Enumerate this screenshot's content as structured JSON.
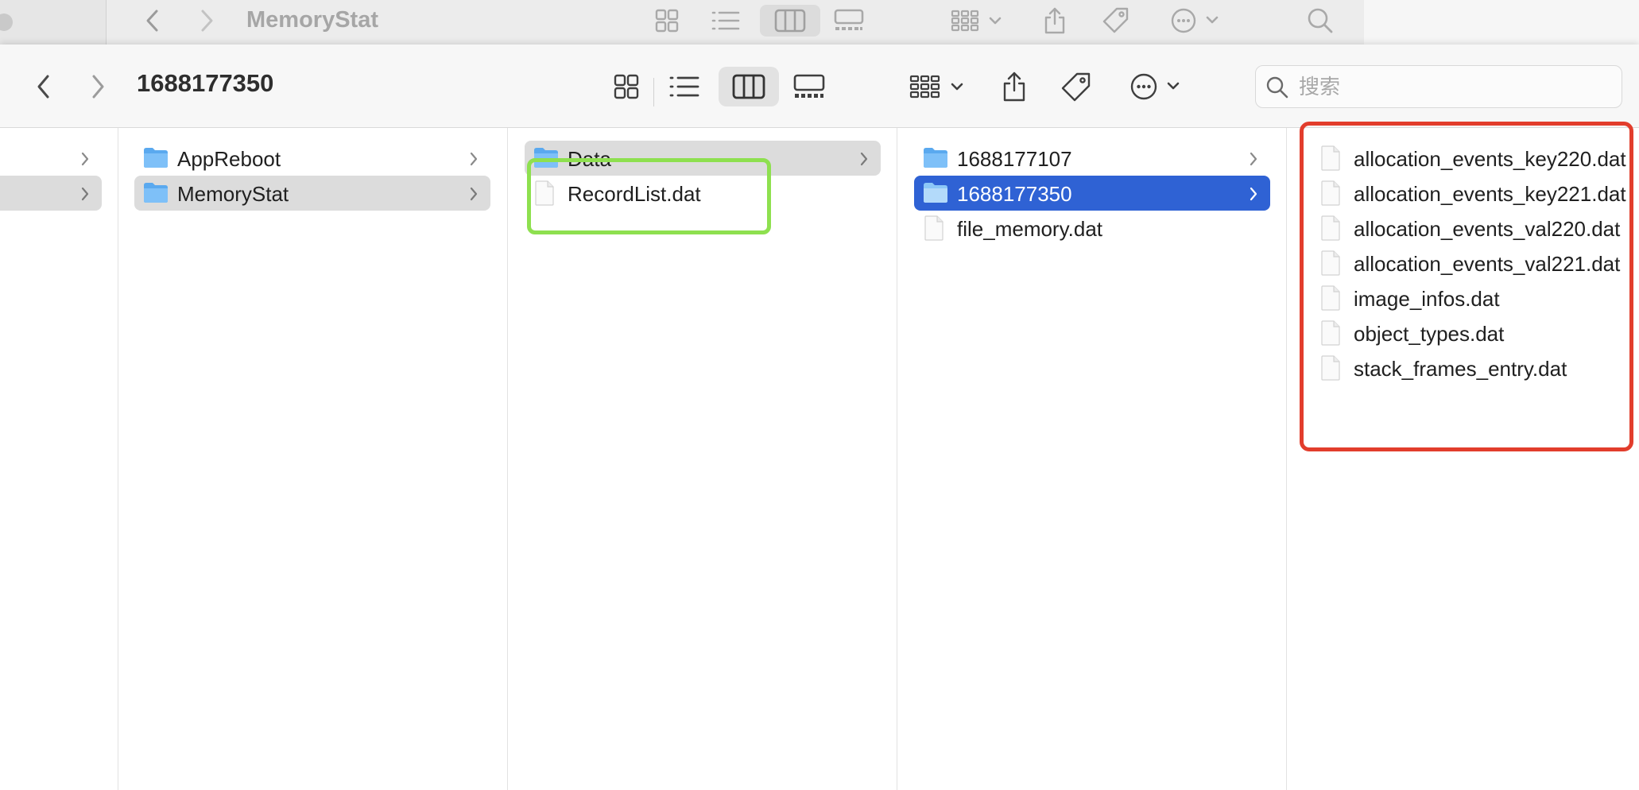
{
  "background_window": {
    "title": "MemoryStat"
  },
  "toolbar": {
    "title": "1688177350",
    "back_icon": "chevron-left-icon",
    "forward_icon": "chevron-right-icon",
    "view_icons": [
      "icon-view-icon",
      "list-view-icon",
      "column-view-icon",
      "gallery-view-icon"
    ],
    "active_view": "column-view-icon",
    "group_icon": "group-by-icon",
    "share_icon": "share-icon",
    "tag_icon": "tag-icon",
    "more_icon": "more-actions-icon"
  },
  "search": {
    "placeholder": "搜索",
    "value": ""
  },
  "columns": {
    "col2": {
      "items": [
        {
          "label": "AppReboot",
          "kind": "folder",
          "selected": false
        },
        {
          "label": "MemoryStat",
          "kind": "folder",
          "selected": "grey"
        }
      ]
    },
    "col3": {
      "items": [
        {
          "label": "Data",
          "kind": "folder",
          "selected": "grey"
        },
        {
          "label": "RecordList.dat",
          "kind": "file",
          "selected": false
        }
      ]
    },
    "col4": {
      "items": [
        {
          "label": "1688177107",
          "kind": "folder",
          "selected": false
        },
        {
          "label": "1688177350",
          "kind": "folder",
          "selected": "blue"
        },
        {
          "label": "file_memory.dat",
          "kind": "file",
          "selected": false
        }
      ]
    },
    "col5": {
      "items": [
        {
          "label": "allocation_events_key220.dat",
          "kind": "file"
        },
        {
          "label": "allocation_events_key221.dat",
          "kind": "file"
        },
        {
          "label": "allocation_events_val220.dat",
          "kind": "file"
        },
        {
          "label": "allocation_events_val221.dat",
          "kind": "file"
        },
        {
          "label": "image_infos.dat",
          "kind": "file"
        },
        {
          "label": "object_types.dat",
          "kind": "file"
        },
        {
          "label": "stack_frames_entry.dat",
          "kind": "file"
        }
      ]
    }
  },
  "colors": {
    "selection_blue": "#2f62d4",
    "selection_grey": "#dcdcdc",
    "annotation_green": "#8ee04f",
    "annotation_red": "#e23d2c",
    "folder_blue": "#6cb6f5"
  }
}
